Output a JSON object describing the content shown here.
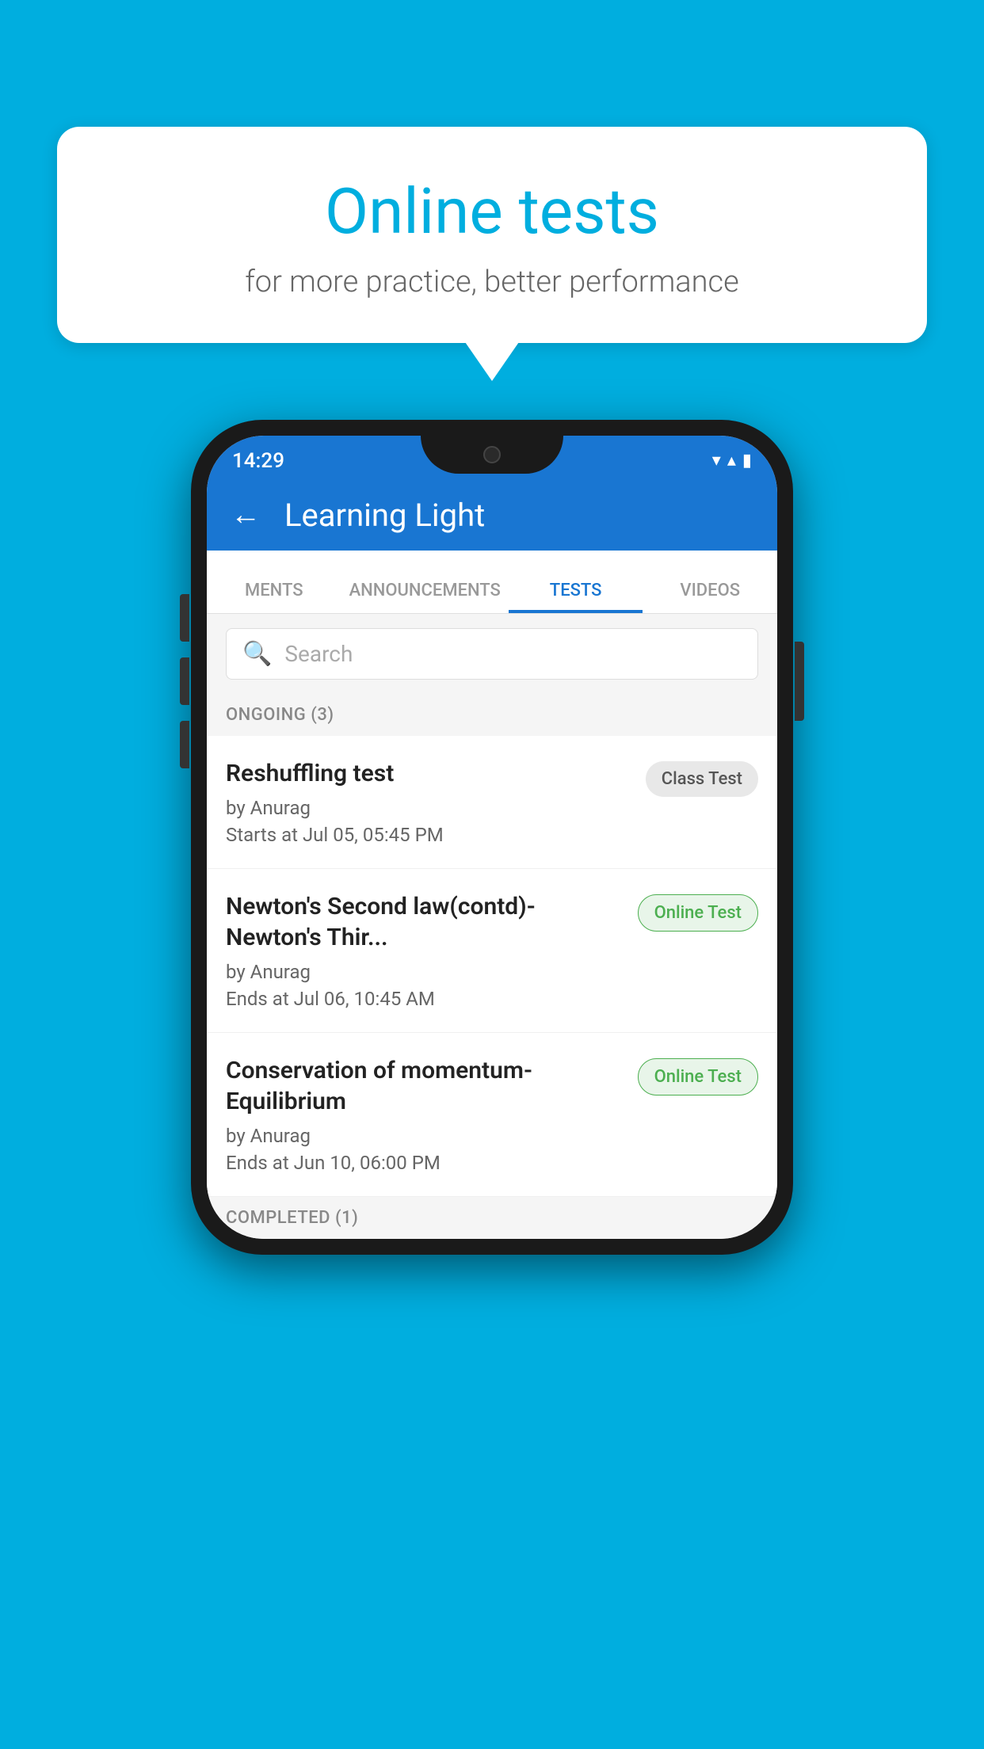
{
  "background": {
    "color": "#00AEDF"
  },
  "speech_bubble": {
    "title": "Online tests",
    "subtitle": "for more practice, better performance"
  },
  "phone": {
    "status_bar": {
      "time": "14:29",
      "wifi": "▼",
      "signal": "▲",
      "battery": "▮"
    },
    "header": {
      "back_label": "←",
      "app_name": "Learning Light"
    },
    "tabs": [
      {
        "label": "MENTS",
        "active": false
      },
      {
        "label": "ANNOUNCEMENTS",
        "active": false
      },
      {
        "label": "TESTS",
        "active": true
      },
      {
        "label": "VIDEOS",
        "active": false
      }
    ],
    "search": {
      "placeholder": "Search"
    },
    "ongoing_section": {
      "label": "ONGOING (3)"
    },
    "tests": [
      {
        "name": "Reshuffling test",
        "author": "by Anurag",
        "time_label": "Starts at",
        "time": "Jul 05, 05:45 PM",
        "badge": "Class Test",
        "badge_type": "class"
      },
      {
        "name": "Newton's Second law(contd)-Newton's Thir...",
        "author": "by Anurag",
        "time_label": "Ends at",
        "time": "Jul 06, 10:45 AM",
        "badge": "Online Test",
        "badge_type": "online"
      },
      {
        "name": "Conservation of momentum-Equilibrium",
        "author": "by Anurag",
        "time_label": "Ends at",
        "time": "Jun 10, 06:00 PM",
        "badge": "Online Test",
        "badge_type": "online"
      }
    ],
    "completed_section": {
      "label": "COMPLETED (1)"
    }
  }
}
